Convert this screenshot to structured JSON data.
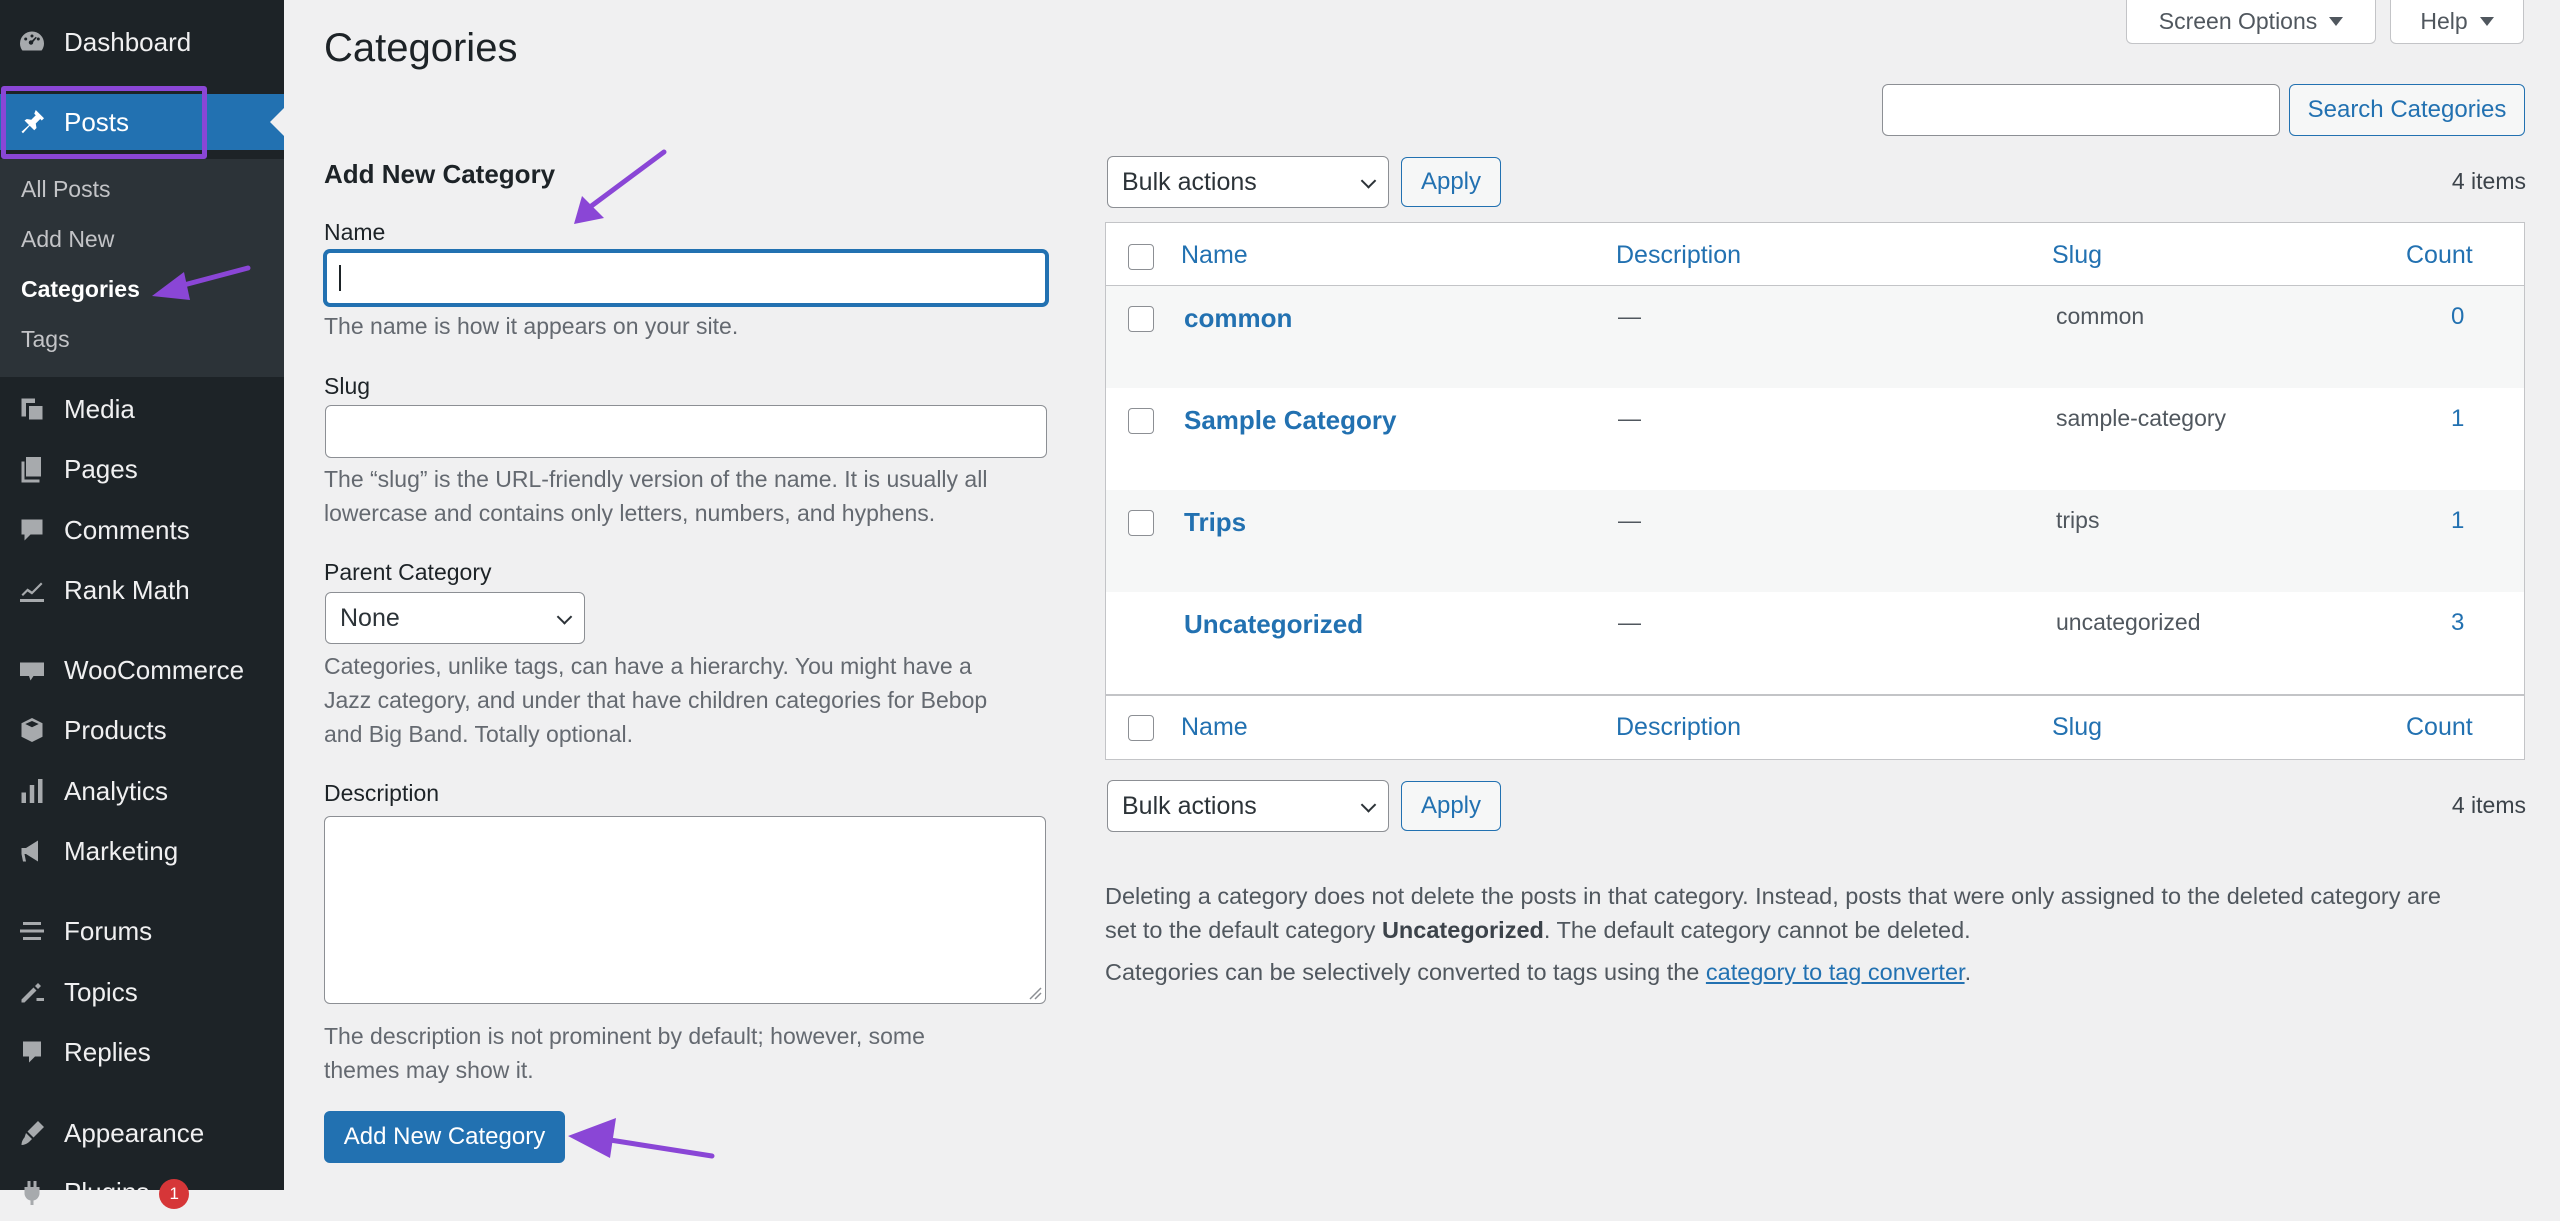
{
  "sidebar": {
    "dashboard": "Dashboard",
    "posts": "Posts",
    "submenu": [
      "All Posts",
      "Add New",
      "Categories",
      "Tags"
    ],
    "media": "Media",
    "pages": "Pages",
    "comments": "Comments",
    "rank_math": "Rank Math",
    "woocommerce": "WooCommerce",
    "products": "Products",
    "analytics": "Analytics",
    "marketing": "Marketing",
    "forums": "Forums",
    "topics": "Topics",
    "replies": "Replies",
    "appearance": "Appearance",
    "plugins": "Plugins",
    "plugins_badge": "1"
  },
  "header": {
    "screen_options": "Screen Options",
    "help": "Help",
    "page_title": "Categories"
  },
  "form": {
    "heading": "Add New Category",
    "name_label": "Name",
    "name_value": "",
    "name_help": "The name is how it appears on your site.",
    "slug_label": "Slug",
    "slug_value": "",
    "slug_help_1": "The “slug” is the URL-friendly version of the name. It is usually all",
    "slug_help_2": "lowercase and contains only letters, numbers, and hyphens.",
    "parent_label": "Parent Category",
    "parent_value": "None",
    "parent_help_1": "Categories, unlike tags, can have a hierarchy. You might have a",
    "parent_help_2": "Jazz category, and under that have children categories for Bebop",
    "parent_help_3": "and Big Band. Totally optional.",
    "description_label": "Description",
    "description_value": "",
    "description_help_1": "The description is not prominent by default; however, some",
    "description_help_2": "themes may show it.",
    "submit_label": "Add New Category"
  },
  "search": {
    "value": "",
    "button_label": "Search Categories"
  },
  "bulk": {
    "top_select": "Bulk actions",
    "top_apply": "Apply",
    "bottom_select": "Bulk actions",
    "bottom_apply": "Apply",
    "items_count": "4 items"
  },
  "table": {
    "columns": [
      "Name",
      "Description",
      "Slug",
      "Count"
    ],
    "rows": [
      {
        "name": "common",
        "description": "—",
        "slug": "common",
        "count": "0"
      },
      {
        "name": "Sample Category",
        "description": "—",
        "slug": "sample-category",
        "count": "1"
      },
      {
        "name": "Trips",
        "description": "—",
        "slug": "trips",
        "count": "1"
      },
      {
        "name": "Uncategorized",
        "description": "—",
        "slug": "uncategorized",
        "count": "3"
      }
    ]
  },
  "notes": {
    "line1_a": "Deleting a category does not delete the posts in that category. Instead, posts that were only assigned to the deleted category are",
    "line2_a": "set to the default category ",
    "line2_bold": "Uncategorized",
    "line2_b": ". The default category cannot be deleted.",
    "line3_a": "Categories can be selectively converted to tags using the ",
    "line3_link": "category to tag converter",
    "line3_b": "."
  },
  "colors": {
    "sidebar_bg": "#1d2327",
    "accent": "#2271b1",
    "annotation": "#8c4fd8"
  },
  "icons": [
    "dashboard-icon",
    "pin-icon",
    "media-icon",
    "pages-icon",
    "comments-icon",
    "rank-math-icon",
    "woocommerce-icon",
    "products-icon",
    "analytics-icon",
    "marketing-icon",
    "forums-icon",
    "topics-icon",
    "replies-icon",
    "appearance-icon",
    "plugins-icon"
  ]
}
